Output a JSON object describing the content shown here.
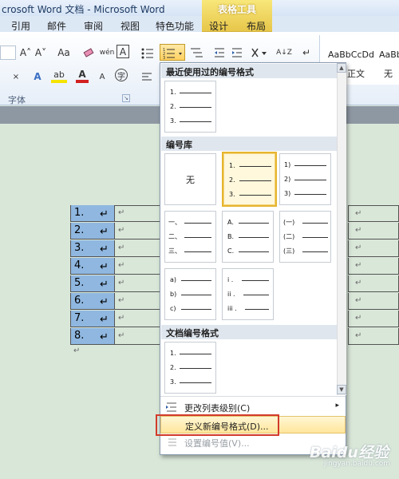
{
  "window": {
    "title": "crosoft Word 文档 - Microsoft Word"
  },
  "ribbon_tabs": {
    "contextual_group": "表格工具",
    "tabs": [
      "引用",
      "邮件",
      "审阅",
      "视图",
      "特色功能",
      "设计",
      "布局"
    ]
  },
  "ribbon": {
    "font_group_label": "字体",
    "launcher_glyph": "↘",
    "buttons": {
      "grow_font": "A˄",
      "shrink_font": "A˅",
      "change_case": "Aa",
      "phonetic": "wén",
      "char_border": "A",
      "text_effect": "A",
      "highlight": "ab",
      "font_color": "A",
      "enclose_char": "字",
      "sort": "A↓Z",
      "para_mark": "↵"
    },
    "styles": [
      "AaBbCcDd",
      "AaBb",
      "正文",
      "无"
    ]
  },
  "table": {
    "rows": [
      "1.",
      "2.",
      "3.",
      "4.",
      "5.",
      "6.",
      "7.",
      "8."
    ],
    "para_mark": "↵"
  },
  "menu": {
    "recent_header": "最近使用过的编号格式",
    "library_header": "编号库",
    "document_header": "文档编号格式",
    "none_label": "无",
    "formats": {
      "arabic": [
        "1.",
        "2.",
        "3."
      ],
      "paren": [
        "1)",
        "2)",
        "3)"
      ],
      "chinese": [
        "一、",
        "二、",
        "三、"
      ],
      "upper": [
        "A.",
        "B.",
        "C."
      ],
      "chinese_paren": [
        "(一)",
        "(二)",
        "(三)"
      ],
      "lower": [
        "a)",
        "b)",
        "c)"
      ],
      "roman": [
        "i .",
        "ii .",
        "iii ."
      ]
    },
    "items": {
      "change_level": "更改列表级别(C)",
      "define_new": "定义新编号格式(D)...",
      "set_value": "设置编号值(V)..."
    },
    "scroll_up": "▲",
    "scroll_down": "▼"
  },
  "watermark": {
    "line1": "Baidu经验",
    "line2": "jingyan.baidu.com"
  },
  "colors": {
    "selected_tile": "#e6b52f",
    "highlight_cells": "#8fb7e0",
    "red_box": "#d23a2b"
  }
}
